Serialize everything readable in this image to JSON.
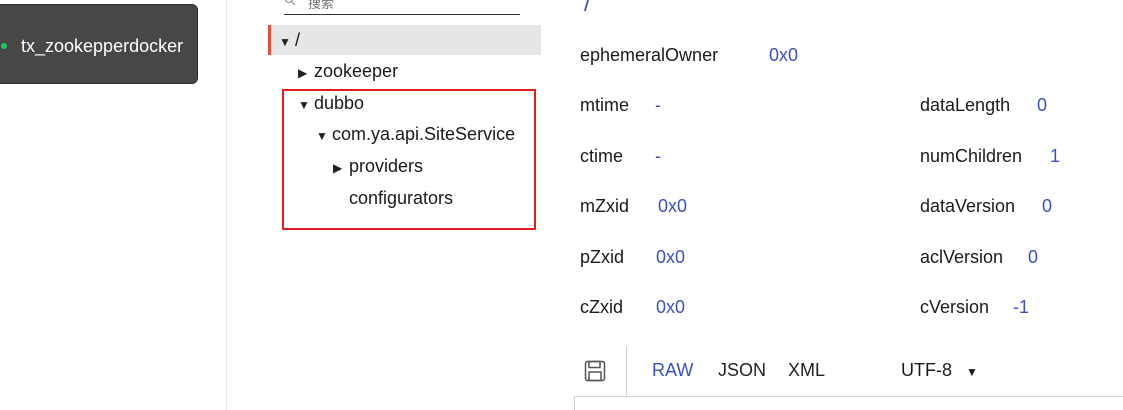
{
  "connection": {
    "name": "tx_zookepperdocker",
    "status_color": "#22c55e"
  },
  "search": {
    "placeholder": "搜索",
    "icon": "search-icon"
  },
  "tree": {
    "root": {
      "label": "/",
      "caret": "▼"
    },
    "zookeeper": {
      "label": "zookeeper",
      "caret": "▶"
    },
    "dubbo": {
      "label": "dubbo",
      "caret": "▼"
    },
    "service": {
      "label": "com.ya.api.SiteService",
      "caret": "▼"
    },
    "providers": {
      "label": "providers",
      "caret": "▶"
    },
    "configurators": {
      "label": "configurators"
    }
  },
  "details": {
    "path": "/",
    "stats": {
      "ephemeralOwner": {
        "label": "ephemeralOwner",
        "value": "0x0"
      },
      "mtime": {
        "label": "mtime",
        "value": "-"
      },
      "ctime": {
        "label": "ctime",
        "value": "-"
      },
      "mZxid": {
        "label": "mZxid",
        "value": "0x0"
      },
      "pZxid": {
        "label": "pZxid",
        "value": "0x0"
      },
      "cZxid": {
        "label": "cZxid",
        "value": "0x0"
      },
      "dataLength": {
        "label": "dataLength",
        "value": "0"
      },
      "numChildren": {
        "label": "numChildren",
        "value": "1"
      },
      "dataVersion": {
        "label": "dataVersion",
        "value": "0"
      },
      "aclVersion": {
        "label": "aclVersion",
        "value": "0"
      },
      "cVersion": {
        "label": "cVersion",
        "value": "-1"
      }
    }
  },
  "toolbar": {
    "raw": "RAW",
    "json": "JSON",
    "xml": "XML",
    "encoding": "UTF-8",
    "encoding_caret": "▼"
  },
  "colors": {
    "accent": "#3a52b8",
    "selected_marker": "#e74c3c",
    "highlight_box": "#e11d1d"
  }
}
